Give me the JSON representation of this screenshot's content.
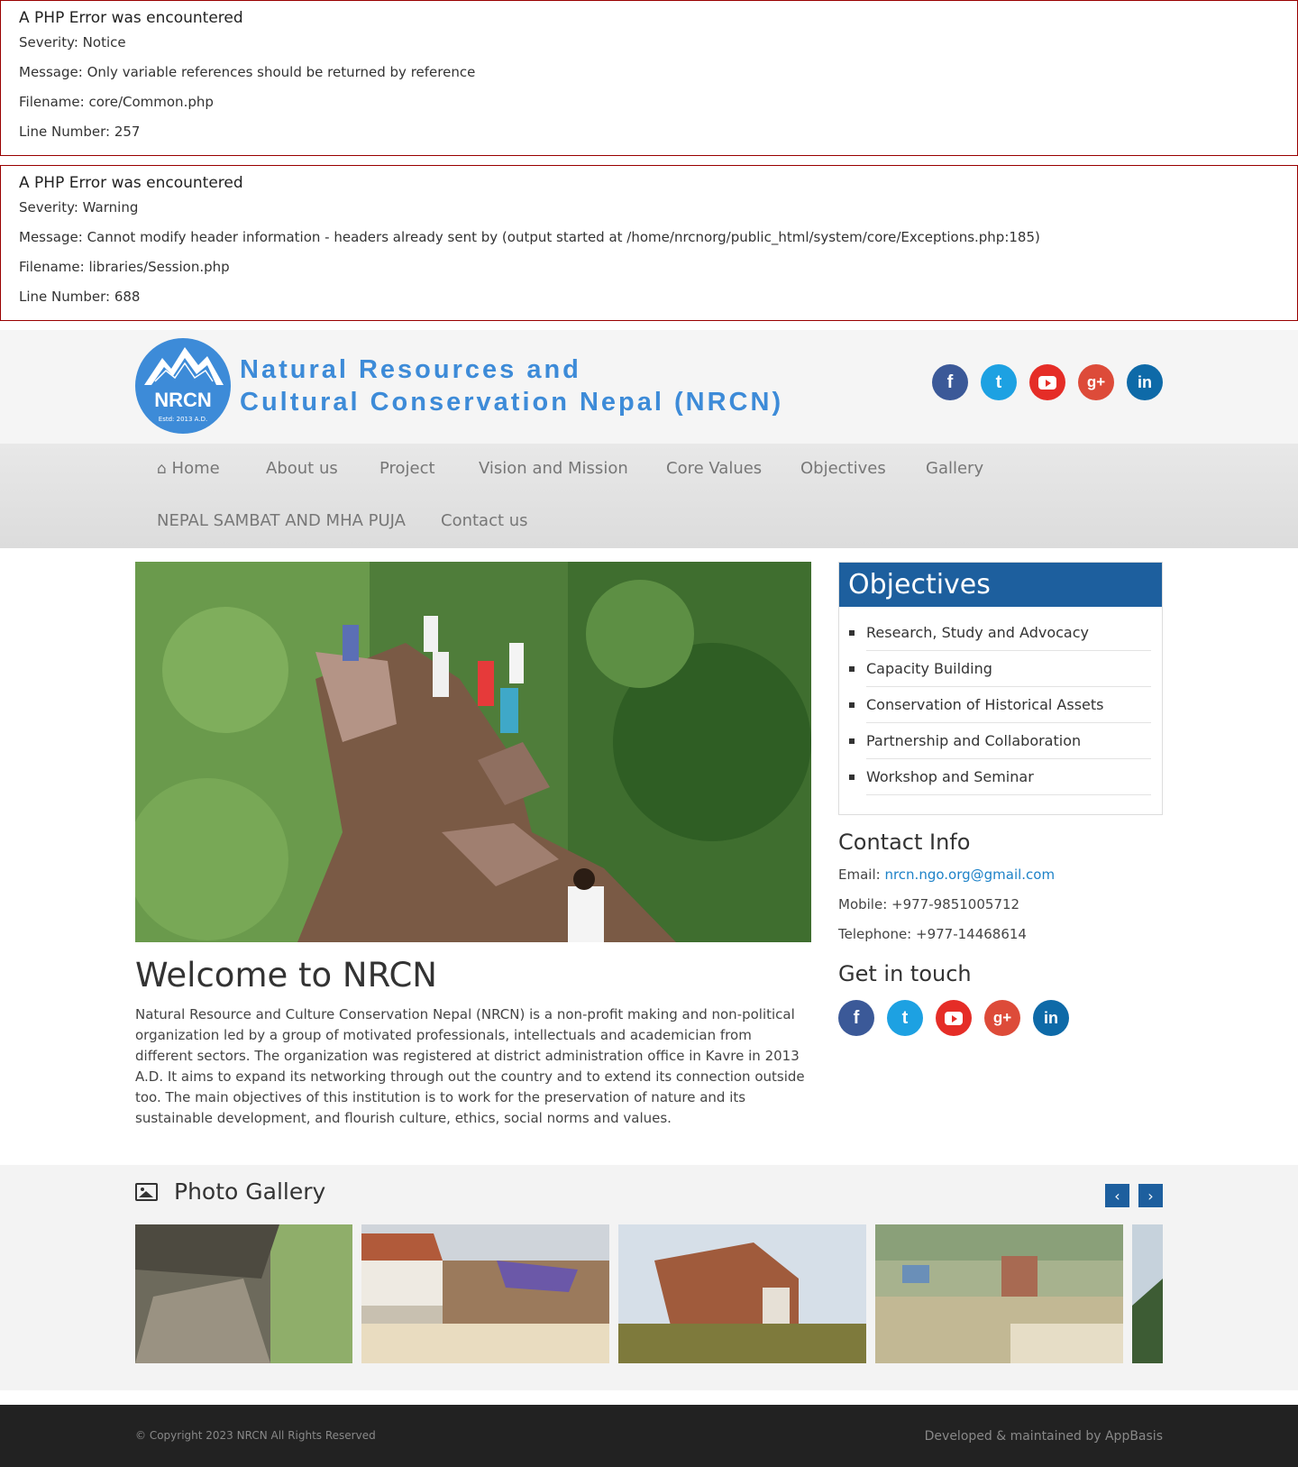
{
  "errors": [
    {
      "title": "A PHP Error was encountered",
      "severity": "Severity: Notice",
      "message": "Message: Only variable references should be returned by reference",
      "filename": "Filename: core/Common.php",
      "line": "Line Number: 257"
    },
    {
      "title": "A PHP Error was encountered",
      "severity": "Severity: Warning",
      "message": "Message: Cannot modify header information - headers already sent by (output started at /home/nrcnorg/public_html/system/core/Exceptions.php:185)",
      "filename": "Filename: libraries/Session.php",
      "line": "Line Number: 688"
    }
  ],
  "header": {
    "logo_abbr": "NRCN",
    "logo_estd": "Estd: 2013 A.D.",
    "logo_line1": "Natural Resources and",
    "logo_line2": "Cultural Conservation Nepal (NRCN)",
    "brand_color": "#3d8bd8",
    "social": [
      "facebook-icon",
      "twitter-icon",
      "youtube-icon",
      "google-plus-icon",
      "linkedin-icon"
    ]
  },
  "nav": {
    "items": [
      "Home",
      "About us",
      "Project",
      "Vision and Mission",
      "Core Values",
      "Objectives",
      "Gallery",
      "NEPAL SAMBAT AND MHA PUJA",
      "Contact us"
    ],
    "home_icon": "home-icon"
  },
  "main": {
    "welcome_title": "Welcome to NRCN",
    "welcome_body": "Natural Resource and Culture Conservation Nepal (NRCN) is a non-profit making and non-political organization led by a  group  of  motivated professionals, intellectuals and academician from different sectors. The organization was registered at district administration office in Kavre in 2013 A.D. It aims to expand its networking through out the country and to extend its connection outside too. The main objectives of this institution is to work for the  preservation  of  nature  and  its sustainable development, and flourish culture, ethics, social norms and values."
  },
  "sidebar": {
    "objectives_title": "Objectives",
    "objectives": [
      "Research, Study and Advocacy",
      "Capacity Building",
      "Conservation of Historical Assets",
      "Partnership and Collaboration",
      "Workshop and Seminar"
    ],
    "contact_title": "Contact Info",
    "email_label": "Email:",
    "email": "nrcn.ngo.org@gmail.com",
    "mobile": "Mobile: +977-9851005712",
    "telephone": "Telephone: +977-14468614",
    "get_in_touch": "Get in touch",
    "accent_color": "#1d5f9e"
  },
  "gallery": {
    "title": "Photo Gallery",
    "prev_icon": "chevron-left-icon",
    "next_icon": "chevron-right-icon"
  },
  "footer": {
    "copyright": "© Copyright 2023 NRCN All Rights Reserved",
    "credit": "Developed & maintained by AppBasis"
  }
}
